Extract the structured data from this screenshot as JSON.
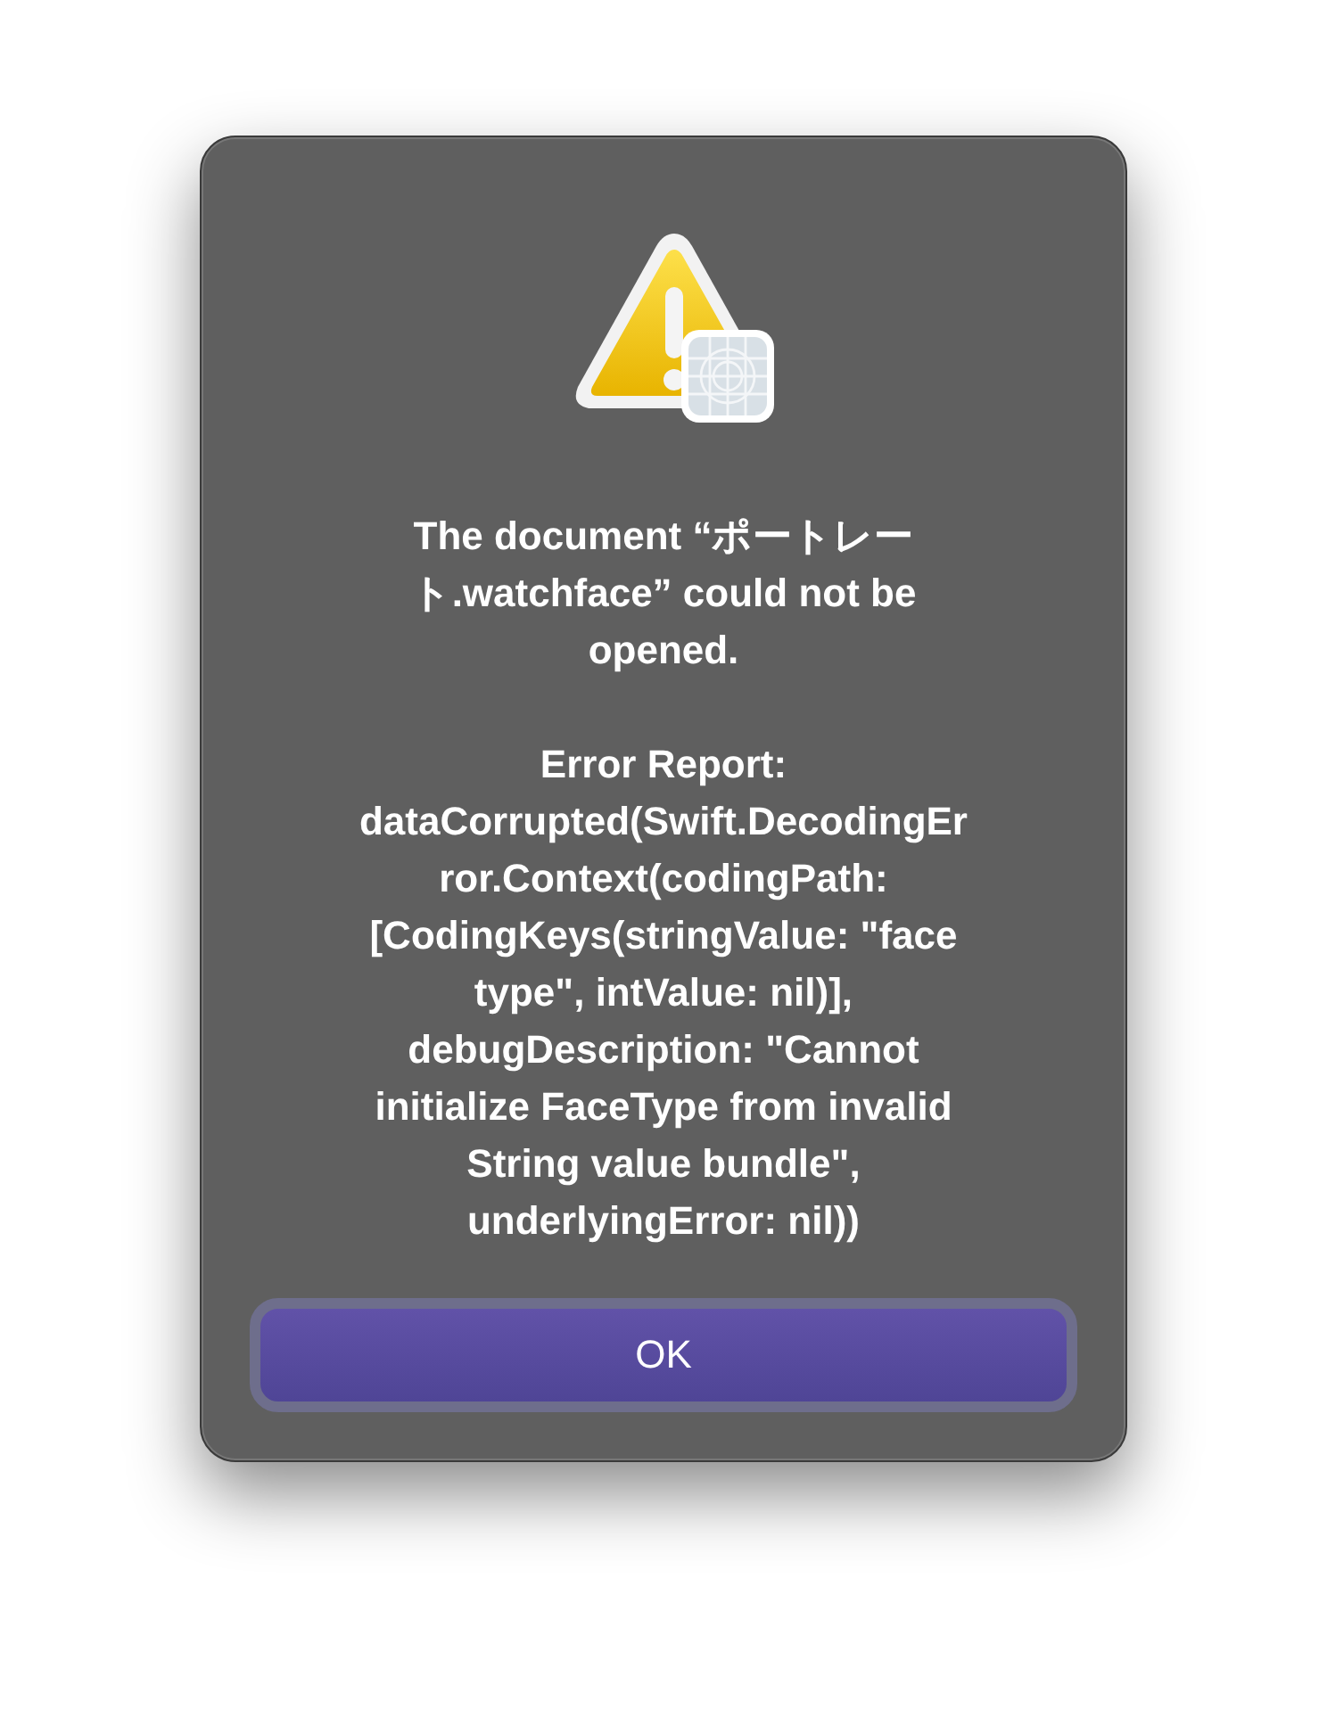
{
  "dialog": {
    "title_lines": [
      "The document “ポートレー",
      "ト.watchface” could not be",
      "opened."
    ],
    "message_lines": [
      "Error Report:",
      "dataCorrupted(Swift.DecodingEr",
      "ror.Context(codingPath:",
      "[CodingKeys(stringValue: \"face",
      "type\", intValue: nil)],",
      "debugDescription: \"Cannot",
      "initialize FaceType from invalid",
      "String value bundle\",",
      "underlyingError: nil))"
    ],
    "buttons": [
      {
        "label": "OK",
        "kind": "default"
      }
    ]
  }
}
